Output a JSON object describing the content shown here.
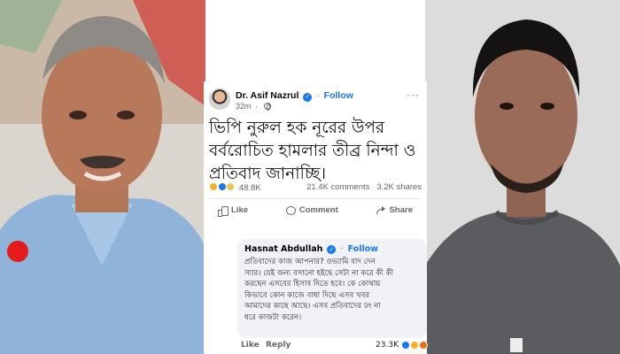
{
  "post": {
    "author": "Dr. Asif Nazrul",
    "verified_mark": "✓",
    "follow_label": "Follow",
    "time": "32m",
    "more": "···",
    "text_lines": [
      "ভিপি নুরুল হক নূরের উপর",
      "বর্বরোচিত হামলার তীব্র নিন্দা ও",
      "প্রতিবাদ জানাচ্ছি।"
    ],
    "reaction_count": "48.8K",
    "comments_count": "21.4K comments",
    "shares_count": "3.2K shares",
    "actions": [
      "Like",
      "Comment",
      "Share"
    ]
  },
  "comment": {
    "author": "Hasnat Abdullah",
    "verified_mark": "✓",
    "follow_label": "Follow",
    "text_lines": [
      "প্রতিবাদের কাজ আপনার? ওভ্যামি বাদ দেন",
      "স্যার। যেই জন্য বসানো হইছে সেটা না করে কী কী",
      "করছেন এসবের হিসাব দিতে হবে। কে কোথায়",
      "কিভাবে কোন কাজে বাধা দিছে এসব খবর",
      "আমাদের কাছে আছে। এসব প্রতিবাদের ঢং না",
      "ধরে কাজটা করেন।"
    ],
    "like_label": "Like",
    "reply_label": "Reply",
    "reaction_count": "23.3K"
  },
  "colors": {
    "facebook_blue": "#1877f2",
    "comment_bubble": "#f0f2f5",
    "comment_avatar": "#e31b1b"
  },
  "icons": [
    "verified-icon",
    "globe-icon",
    "more-icon",
    "like-icon",
    "comment-icon",
    "share-icon"
  ]
}
